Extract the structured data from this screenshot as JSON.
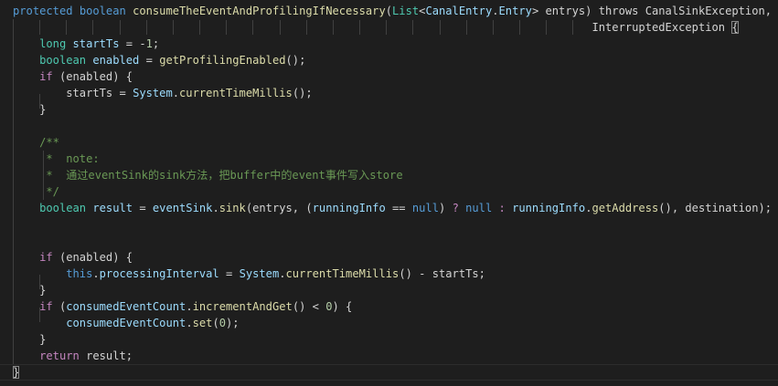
{
  "editor": {
    "colors": {
      "background": "#1e1e1e",
      "keyword": "#569cd6",
      "type": "#4ec9b0",
      "function": "#dcdcaa",
      "variable": "#9cdcfe",
      "comment": "#6a9955",
      "control": "#c586c0",
      "number": "#b5cea8",
      "text": "#d4d4d4"
    },
    "lines": [
      [
        [
          "kw",
          "protected"
        ],
        [
          "tx",
          " "
        ],
        [
          "kw",
          "boolean"
        ],
        [
          "tx",
          " "
        ],
        [
          "fn",
          "consumeTheEventAndProfilingIfNecessary"
        ],
        [
          "tx",
          "("
        ],
        [
          "ty",
          "List"
        ],
        [
          "tx",
          "<"
        ],
        [
          "va",
          "CanalEntry"
        ],
        [
          "tx",
          "."
        ],
        [
          "va",
          "Entry"
        ],
        [
          "tx",
          "> entrys) throws CanalSinkException,"
        ]
      ],
      [
        [
          "tx",
          "                                                                                       InterruptedException "
        ],
        [
          "bm",
          "{"
        ]
      ],
      [
        [
          "tx",
          "    "
        ],
        [
          "ty",
          "long"
        ],
        [
          "tx",
          " "
        ],
        [
          "va",
          "startTs"
        ],
        [
          "tx",
          " = -"
        ],
        [
          "nu",
          "1"
        ],
        [
          "tx",
          ";"
        ]
      ],
      [
        [
          "tx",
          "    "
        ],
        [
          "ty",
          "boolean"
        ],
        [
          "tx",
          " "
        ],
        [
          "va",
          "enabled"
        ],
        [
          "tx",
          " = "
        ],
        [
          "fn",
          "getProfilingEnabled"
        ],
        [
          "tx",
          "();"
        ]
      ],
      [
        [
          "tx",
          "    "
        ],
        [
          "ct",
          "if"
        ],
        [
          "tx",
          " (enabled) {"
        ]
      ],
      [
        [
          "tx",
          "        startTs = "
        ],
        [
          "va",
          "System"
        ],
        [
          "tx",
          "."
        ],
        [
          "fn",
          "currentTimeMillis"
        ],
        [
          "tx",
          "();"
        ]
      ],
      [
        [
          "tx",
          "    }"
        ]
      ],
      [
        [
          "tx",
          ""
        ]
      ],
      [
        [
          "tx",
          "    "
        ],
        [
          "cm",
          "/**"
        ]
      ],
      [
        [
          "tx",
          "     "
        ],
        [
          "cm",
          "*  note:"
        ]
      ],
      [
        [
          "tx",
          "     "
        ],
        [
          "cm",
          "*  通过eventSink的sink方法，把buffer中的event事件写入store"
        ]
      ],
      [
        [
          "tx",
          "     "
        ],
        [
          "cm",
          "*/"
        ]
      ],
      [
        [
          "tx",
          "    "
        ],
        [
          "ty",
          "boolean"
        ],
        [
          "tx",
          " "
        ],
        [
          "va",
          "result"
        ],
        [
          "tx",
          " = "
        ],
        [
          "va",
          "eventSink"
        ],
        [
          "tx",
          "."
        ],
        [
          "fn",
          "sink"
        ],
        [
          "tx",
          "(entrys, ("
        ],
        [
          "va",
          "runningInfo"
        ],
        [
          "tx",
          " == "
        ],
        [
          "kw",
          "null"
        ],
        [
          "tx",
          ") "
        ],
        [
          "ct",
          "?"
        ],
        [
          "tx",
          " "
        ],
        [
          "kw",
          "null"
        ],
        [
          "tx",
          " "
        ],
        [
          "ct",
          ":"
        ],
        [
          "tx",
          " "
        ],
        [
          "va",
          "runningInfo"
        ],
        [
          "tx",
          "."
        ],
        [
          "fn",
          "getAddress"
        ],
        [
          "tx",
          "(), destination);"
        ]
      ],
      [
        [
          "tx",
          ""
        ]
      ],
      [
        [
          "tx",
          ""
        ]
      ],
      [
        [
          "tx",
          "    "
        ],
        [
          "ct",
          "if"
        ],
        [
          "tx",
          " (enabled) {"
        ]
      ],
      [
        [
          "tx",
          "        "
        ],
        [
          "kw",
          "this"
        ],
        [
          "tx",
          "."
        ],
        [
          "va",
          "processingInterval"
        ],
        [
          "tx",
          " = "
        ],
        [
          "va",
          "System"
        ],
        [
          "tx",
          "."
        ],
        [
          "fn",
          "currentTimeMillis"
        ],
        [
          "tx",
          "() - startTs;"
        ]
      ],
      [
        [
          "tx",
          "    }"
        ]
      ],
      [
        [
          "tx",
          "    "
        ],
        [
          "ct",
          "if"
        ],
        [
          "tx",
          " ("
        ],
        [
          "va",
          "consumedEventCount"
        ],
        [
          "tx",
          "."
        ],
        [
          "fn",
          "incrementAndGet"
        ],
        [
          "tx",
          "() < "
        ],
        [
          "nu",
          "0"
        ],
        [
          "tx",
          ") {"
        ]
      ],
      [
        [
          "tx",
          "        "
        ],
        [
          "va",
          "consumedEventCount"
        ],
        [
          "tx",
          "."
        ],
        [
          "fn",
          "set"
        ],
        [
          "tx",
          "("
        ],
        [
          "nu",
          "0"
        ],
        [
          "tx",
          ");"
        ]
      ],
      [
        [
          "tx",
          "    }"
        ]
      ],
      [
        [
          "tx",
          "    "
        ],
        [
          "ct",
          "return"
        ],
        [
          "tx",
          " result;"
        ]
      ],
      [
        [
          "bm",
          "}"
        ]
      ]
    ]
  }
}
